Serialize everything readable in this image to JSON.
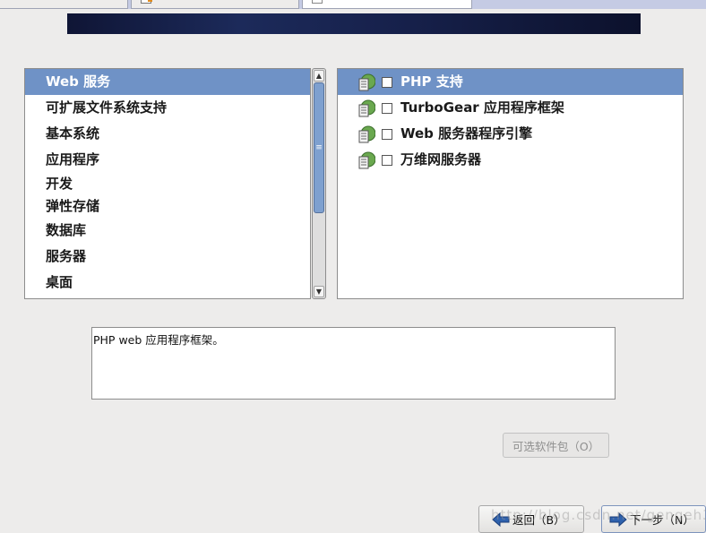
{
  "colors": {
    "selection": "#6f92c6",
    "banner": "#16204a",
    "background": "#edeceb"
  },
  "groups": {
    "items": [
      {
        "label": "Web 服务",
        "selected": true
      },
      {
        "label": "可扩展文件系统支持",
        "selected": false
      },
      {
        "label": "基本系统",
        "selected": false
      },
      {
        "label": "应用程序",
        "selected": false
      },
      {
        "label": "开发",
        "selected": false
      },
      {
        "label": "弹性存储",
        "selected": false
      },
      {
        "label": "数据库",
        "selected": false
      },
      {
        "label": "服务器",
        "selected": false
      },
      {
        "label": "桌面",
        "selected": false
      }
    ]
  },
  "packages": {
    "items": [
      {
        "label": "PHP 支持",
        "checked": false,
        "selected": true,
        "icon": "package-group-icon"
      },
      {
        "label": "TurboGear 应用程序框架",
        "checked": false,
        "selected": false,
        "icon": "package-group-icon"
      },
      {
        "label": "Web 服务器程序引擎",
        "checked": false,
        "selected": false,
        "icon": "package-group-icon"
      },
      {
        "label": "万维网服务器",
        "checked": false,
        "selected": false,
        "icon": "package-group-icon"
      }
    ]
  },
  "description": "PHP web 应用程序框架。",
  "buttons": {
    "optional": "可选软件包（O）",
    "back": "返回（B）",
    "next": "下一步（N）"
  },
  "watermark": "http://blog.csdn.net/gengeh321"
}
